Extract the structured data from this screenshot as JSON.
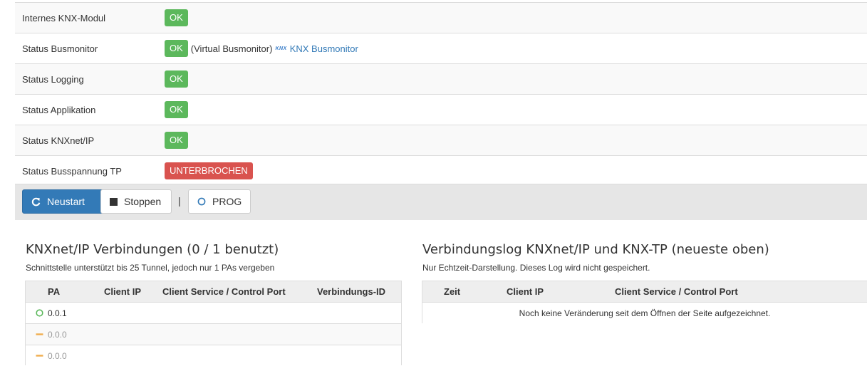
{
  "status": {
    "rows": [
      {
        "label": "Internes KNX-Modul",
        "badge": "OK"
      },
      {
        "label": "Status Busmonitor",
        "badge": "OK",
        "extra": "(Virtual Busmonitor)",
        "logo_text": "KNX",
        "link": "KNX Busmonitor"
      },
      {
        "label": "Status Logging",
        "badge": "OK"
      },
      {
        "label": "Status Applikation",
        "badge": "OK"
      },
      {
        "label": "Status KNXnet/IP",
        "badge": "OK"
      },
      {
        "label": "Status Busspannung TP",
        "badge": "UNTERBROCHEN"
      }
    ]
  },
  "toolbar": {
    "restart_label": "Neustart",
    "stop_label": "Stoppen",
    "separator": "|",
    "prog_label": "PROG"
  },
  "connections": {
    "title": "KNXnet/IP Verbindungen (0 / 1 benutzt)",
    "subtitle": "Schnittstelle unterstützt bis 25 Tunnel, jedoch nur 1 PAs vergeben",
    "columns": [
      "PA",
      "Client IP",
      "Client Service / Control Port",
      "Verbindungs-ID"
    ],
    "rows": [
      {
        "pa": "0.0.1",
        "state": "active"
      },
      {
        "pa": "0.0.0",
        "state": "idle"
      },
      {
        "pa": "0.0.0",
        "state": "idle"
      }
    ]
  },
  "log": {
    "title": "Verbindungslog KNXnet/IP und KNX-TP (neueste oben)",
    "subtitle": "Nur Echtzeit-Darstellung. Dieses Log wird nicht gespeichert.",
    "columns": [
      "Zeit",
      "Client IP",
      "Client Service / Control Port"
    ],
    "empty_message": "Noch keine Veränderung seit dem Öffnen der Seite aufgezeichnet."
  },
  "colors": {
    "ok": "#5cb85c",
    "error": "#d9534f",
    "primary": "#337ab7",
    "active_icon": "#5cb85c",
    "idle_icon": "#f0ad4e"
  }
}
